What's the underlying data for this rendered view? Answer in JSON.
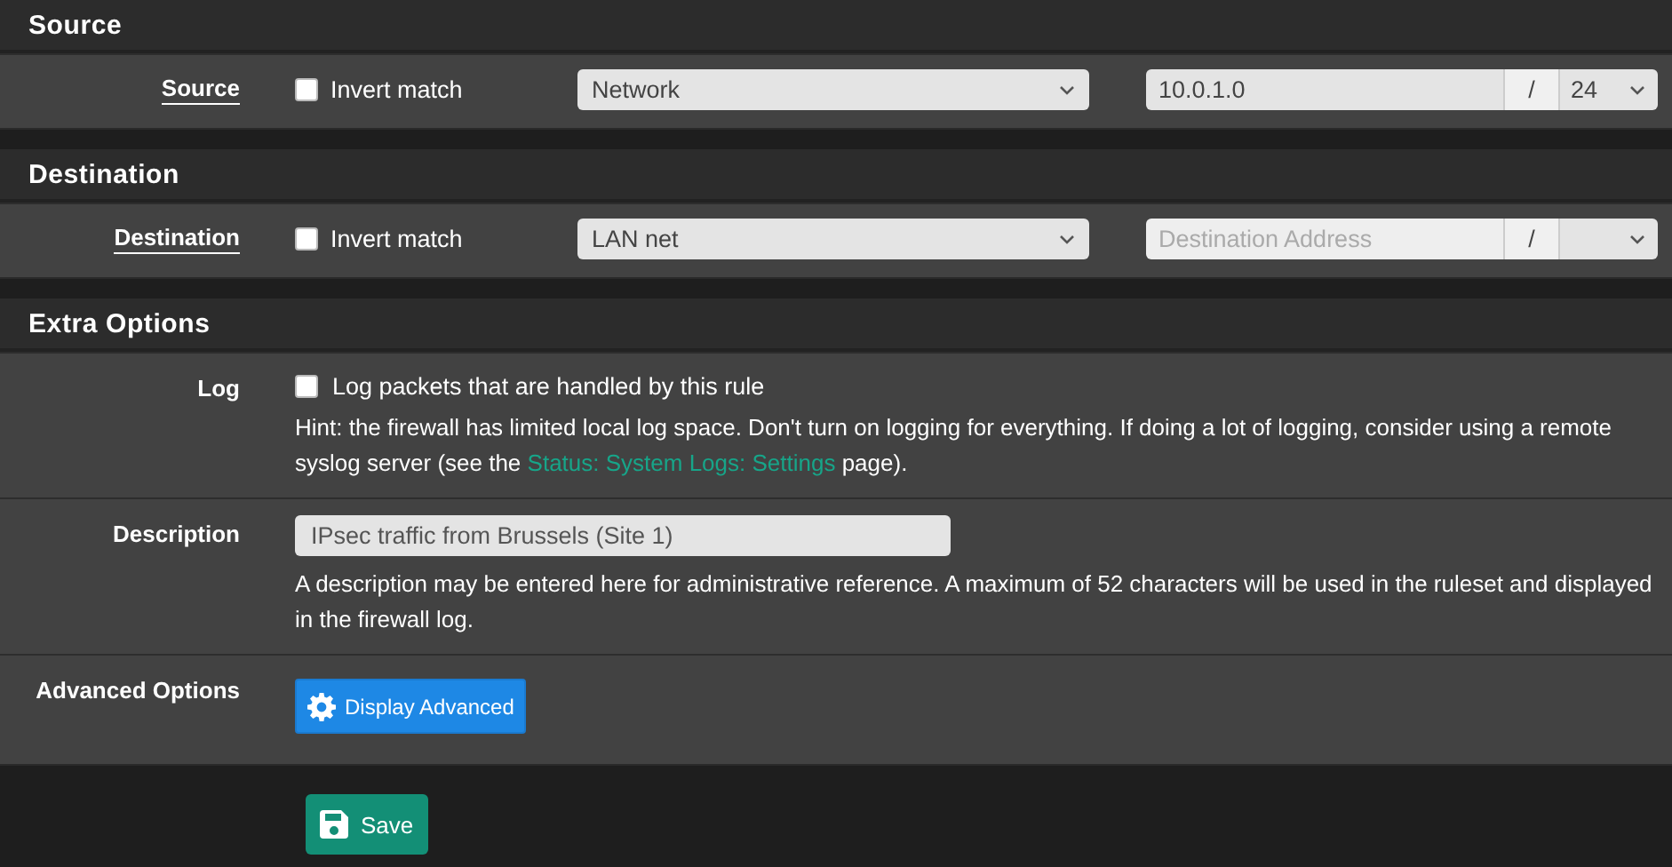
{
  "panels": [
    {
      "title": "Source",
      "rows": [
        {
          "kind": "address",
          "label": "Source",
          "invert": {
            "label": "Invert match",
            "checked": false
          },
          "type_select": "Network",
          "address": {
            "value": "10.0.1.0"
          },
          "separator": "/",
          "mask": "24"
        }
      ]
    },
    {
      "title": "Destination",
      "rows": [
        {
          "kind": "address",
          "label": "Destination",
          "invert": {
            "label": "Invert match",
            "checked": false
          },
          "type_select": "LAN net",
          "address": {
            "placeholder": "Destination Address"
          },
          "separator": "/"
        }
      ]
    },
    {
      "title": "Extra Options",
      "rows": [
        {
          "kind": "checkbox",
          "label": "Log",
          "checkbox": {
            "label": "Log packets that are handled by this rule",
            "checked": false
          },
          "hint": {
            "before": "Hint: the firewall has limited local log space. Don't turn on logging for everything. If doing a lot of logging, consider using a remote syslog server (see the ",
            "link": "Status: System Logs: Settings",
            "after": " page)."
          }
        },
        {
          "kind": "text",
          "label": "Description",
          "value": "IPsec traffic from Brussels (Site 1)",
          "hint": {
            "before": "A description may be entered here for administrative reference. A maximum of 52 characters will be used in the ruleset and displayed in the firewall log."
          }
        },
        {
          "kind": "button",
          "label": "Advanced Options",
          "button": "Display Advanced"
        }
      ]
    }
  ],
  "save_button": "Save"
}
